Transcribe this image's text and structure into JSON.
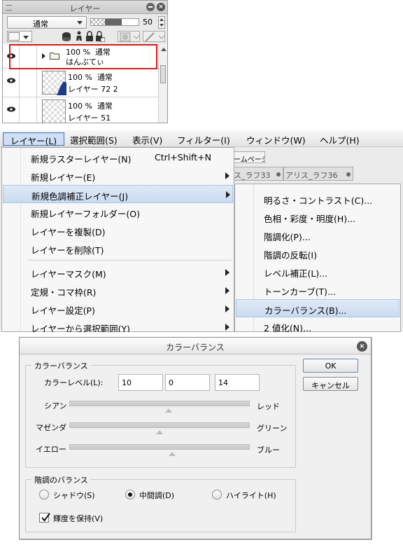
{
  "layer_panel": {
    "title": "レイヤー",
    "blend_mode": "通常",
    "opacity_value": "50",
    "opacity_fraction": 0.5,
    "layers": [
      {
        "line1": "100 %  通常",
        "line2": "はんぶてぃ"
      },
      {
        "line1": "100 %  通常",
        "line2": "レイヤー 72 2"
      },
      {
        "line1": "100 %  通常",
        "line2": "レイヤー 51"
      }
    ]
  },
  "menubar": {
    "items": [
      "レイヤー(L)",
      "選択範囲(S)",
      "表示(V)",
      "フィルター(I)",
      "ウィンドウ(W)",
      "ヘルプ(H)"
    ]
  },
  "background_tabs": {
    "homepage": "ームページ",
    "doc1": "ス_ラフ33",
    "doc2": "アリス_ラフ36"
  },
  "layer_menu": {
    "items": [
      {
        "label": "新規ラスターレイヤー(N)",
        "shortcut": "Ctrl+Shift+N"
      },
      {
        "label": "新規レイヤー(E)"
      },
      {
        "label": "新規色調補正レイヤー(J)"
      },
      {
        "label": "新規レイヤーフォルダー(O)"
      },
      {
        "label": "レイヤーを複製(D)"
      },
      {
        "label": "レイヤーを削除(T)"
      },
      {
        "label": "レイヤーマスク(M)"
      },
      {
        "label": "定規・コマ枠(R)"
      },
      {
        "label": "レイヤー設定(P)"
      },
      {
        "label": "レイヤーから選択範囲(Y)"
      }
    ]
  },
  "adjust_submenu": {
    "items": [
      "明るさ・コントラスト(C)...",
      "色相・彩度・明度(H)...",
      "階調化(P)...",
      "階調の反転(I)",
      "レベル補正(L)...",
      "トーンカーブ(T)...",
      "カラーバランス(B)...",
      "2 値化(N)..."
    ]
  },
  "dialog": {
    "title": "カラーバランス",
    "ok": "OK",
    "cancel": "キャンセル",
    "color_balance_group": "カラーバランス",
    "level_label": "カラーレベル(L):",
    "levels": [
      "10",
      "0",
      "14"
    ],
    "sliders": [
      {
        "left": "シアン",
        "right": "レッド",
        "value": 10
      },
      {
        "left": "マゼンダ",
        "right": "グリーン",
        "value": 0
      },
      {
        "left": "イエロー",
        "right": "ブルー",
        "value": 14
      }
    ],
    "slider_range": [
      -100,
      100
    ],
    "tone_group": "階調のバランス",
    "tones": [
      "シャドウ(S)",
      "中間調(D)",
      "ハイライト(H)"
    ],
    "selected_tone": "中間調(D)",
    "preserve_luminosity": "輝度を保持(V)",
    "preserve_luminosity_checked": true
  },
  "colors": {
    "highlight_outline": "#d41b1b",
    "menu_highlight": "#c9dbf0"
  }
}
